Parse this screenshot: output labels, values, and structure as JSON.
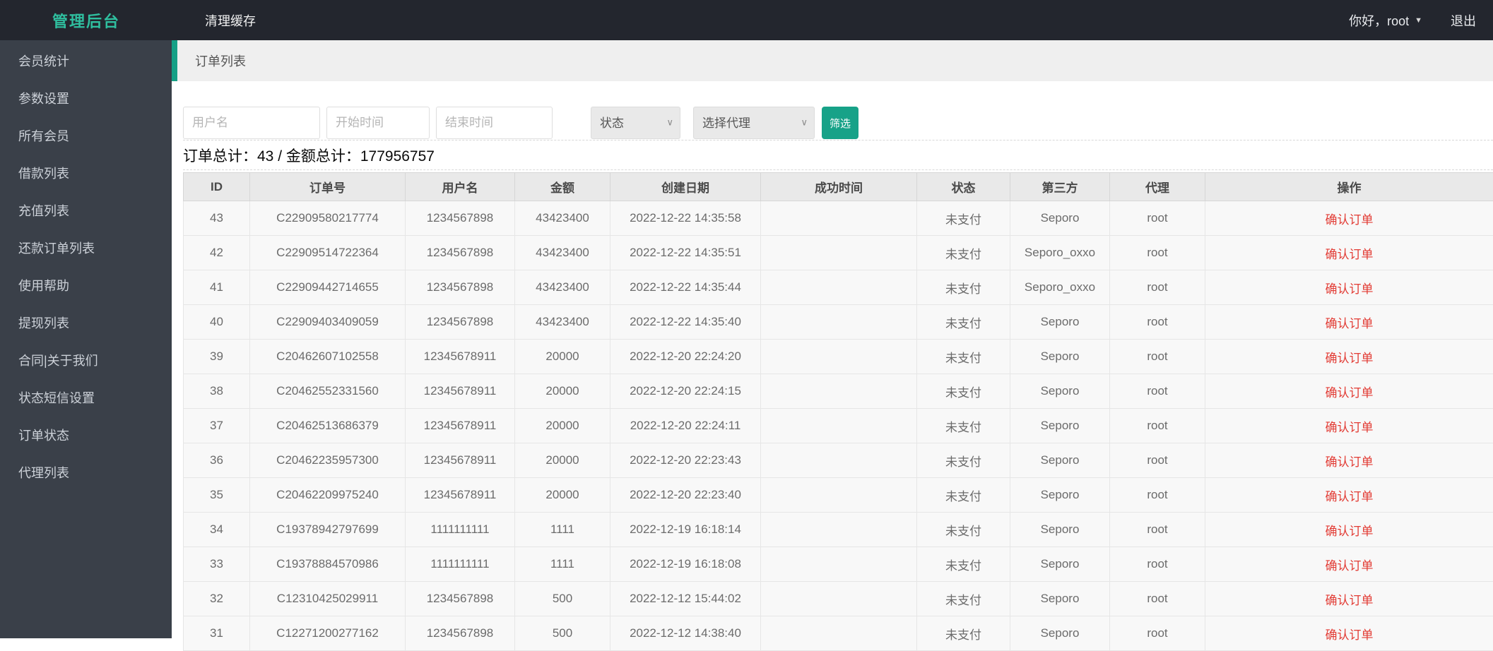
{
  "topbar": {
    "brand": "管理后台",
    "clear_cache": "清理缓存",
    "greeting": "你好，root",
    "logout": "退出"
  },
  "sidebar": {
    "items": [
      "会员统计",
      "参数设置",
      "所有会员",
      "借款列表",
      "充值列表",
      "还款订单列表",
      "使用帮助",
      "提现列表",
      "合同|关于我们",
      "状态短信设置",
      "订单状态",
      "代理列表"
    ]
  },
  "page": {
    "title": "订单列表",
    "filters": {
      "username_placeholder": "用户名",
      "start_placeholder": "开始时间",
      "end_placeholder": "结束时间",
      "status_value": "状态",
      "agent_value": "选择代理",
      "submit_label": "筛选"
    },
    "summary": {
      "text": "订单总计：43 / 金额总计：177956757",
      "orders_total": 43,
      "amount_total": 177956757
    },
    "table": {
      "columns": [
        "ID",
        "订单号",
        "用户名",
        "金额",
        "创建日期",
        "成功时间",
        "状态",
        "第三方",
        "代理",
        "操作"
      ],
      "rows": [
        {
          "id": "43",
          "order_no": "C22909580217774",
          "username": "1234567898",
          "amount": "43423400",
          "created_at": "2022-12-22 14:35:58",
          "success_at": "",
          "status": "未支付",
          "third_party": "Seporo",
          "agent": "root",
          "action": "确认订单"
        },
        {
          "id": "42",
          "order_no": "C22909514722364",
          "username": "1234567898",
          "amount": "43423400",
          "created_at": "2022-12-22 14:35:51",
          "success_at": "",
          "status": "未支付",
          "third_party": "Seporo_oxxo",
          "agent": "root",
          "action": "确认订单"
        },
        {
          "id": "41",
          "order_no": "C22909442714655",
          "username": "1234567898",
          "amount": "43423400",
          "created_at": "2022-12-22 14:35:44",
          "success_at": "",
          "status": "未支付",
          "third_party": "Seporo_oxxo",
          "agent": "root",
          "action": "确认订单"
        },
        {
          "id": "40",
          "order_no": "C22909403409059",
          "username": "1234567898",
          "amount": "43423400",
          "created_at": "2022-12-22 14:35:40",
          "success_at": "",
          "status": "未支付",
          "third_party": "Seporo",
          "agent": "root",
          "action": "确认订单"
        },
        {
          "id": "39",
          "order_no": "C20462607102558",
          "username": "12345678911",
          "amount": "20000",
          "created_at": "2022-12-20 22:24:20",
          "success_at": "",
          "status": "未支付",
          "third_party": "Seporo",
          "agent": "root",
          "action": "确认订单"
        },
        {
          "id": "38",
          "order_no": "C20462552331560",
          "username": "12345678911",
          "amount": "20000",
          "created_at": "2022-12-20 22:24:15",
          "success_at": "",
          "status": "未支付",
          "third_party": "Seporo",
          "agent": "root",
          "action": "确认订单"
        },
        {
          "id": "37",
          "order_no": "C20462513686379",
          "username": "12345678911",
          "amount": "20000",
          "created_at": "2022-12-20 22:24:11",
          "success_at": "",
          "status": "未支付",
          "third_party": "Seporo",
          "agent": "root",
          "action": "确认订单"
        },
        {
          "id": "36",
          "order_no": "C20462235957300",
          "username": "12345678911",
          "amount": "20000",
          "created_at": "2022-12-20 22:23:43",
          "success_at": "",
          "status": "未支付",
          "third_party": "Seporo",
          "agent": "root",
          "action": "确认订单"
        },
        {
          "id": "35",
          "order_no": "C20462209975240",
          "username": "12345678911",
          "amount": "20000",
          "created_at": "2022-12-20 22:23:40",
          "success_at": "",
          "status": "未支付",
          "third_party": "Seporo",
          "agent": "root",
          "action": "确认订单"
        },
        {
          "id": "34",
          "order_no": "C19378942797699",
          "username": "1111111111",
          "amount": "1111",
          "created_at": "2022-12-19 16:18:14",
          "success_at": "",
          "status": "未支付",
          "third_party": "Seporo",
          "agent": "root",
          "action": "确认订单"
        },
        {
          "id": "33",
          "order_no": "C19378884570986",
          "username": "1111111111",
          "amount": "1111",
          "created_at": "2022-12-19 16:18:08",
          "success_at": "",
          "status": "未支付",
          "third_party": "Seporo",
          "agent": "root",
          "action": "确认订单"
        },
        {
          "id": "32",
          "order_no": "C12310425029911",
          "username": "1234567898",
          "amount": "500",
          "created_at": "2022-12-12 15:44:02",
          "success_at": "",
          "status": "未支付",
          "third_party": "Seporo",
          "agent": "root",
          "action": "确认订单"
        },
        {
          "id": "31",
          "order_no": "C12271200277162",
          "username": "1234567898",
          "amount": "500",
          "created_at": "2022-12-12 14:38:40",
          "success_at": "",
          "status": "未支付",
          "third_party": "Seporo",
          "agent": "root",
          "action": "确认订单"
        }
      ]
    }
  },
  "colors": {
    "topbar_bg": "#23262e",
    "sidebar_bg": "#3a4049",
    "brand_teal": "#2fbf9f",
    "accent_teal": "#16a086",
    "button_teal": "#17a288",
    "action_red": "#e23b34"
  }
}
